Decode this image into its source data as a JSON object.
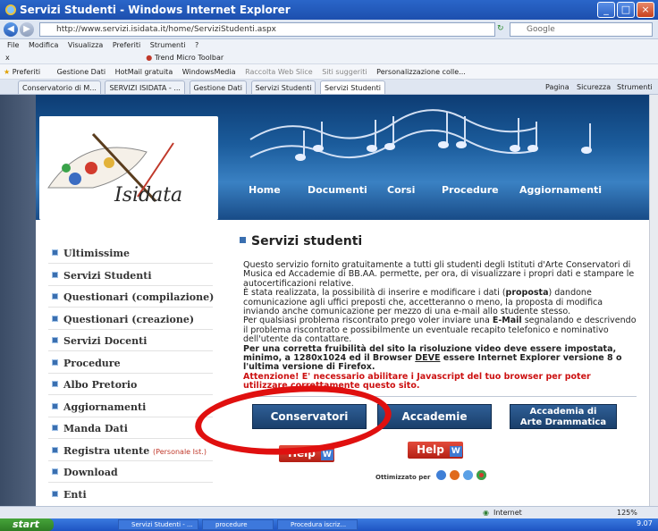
{
  "window": {
    "title": "Servizi Studenti - Windows Internet Explorer"
  },
  "address": {
    "url": "http://www.servizi.isidata.it/home/ServiziStudenti.aspx",
    "search_placeholder": "Google"
  },
  "menu": {
    "items": [
      "File",
      "Modifica",
      "Visualizza",
      "Preferiti",
      "Strumenti",
      "?"
    ]
  },
  "toolbar": {
    "trend": "Trend Micro Toolbar",
    "close": "x"
  },
  "favorites": {
    "label": "Preferiti",
    "items": [
      "Gestione Dati",
      "HotMail gratuita",
      "WindowsMedia",
      "Raccolta Web Slice",
      "Siti suggeriti",
      "Personalizzazione colle..."
    ]
  },
  "tabs": {
    "items": [
      "Conservatorio di M...",
      "SERVIZI ISIDATA - ...",
      "Gestione Dati",
      "Servizi Studenti",
      "Servizi Studenti"
    ],
    "right": [
      "Pagina",
      "Sicurezza",
      "Strumenti"
    ]
  },
  "site": {
    "logo_text": "Isidata",
    "nav": [
      "Home",
      "Documenti",
      "Corsi",
      "Procedure",
      "Aggiornamenti"
    ],
    "sidebar": [
      {
        "label": "Ultimissime"
      },
      {
        "label": "Servizi Studenti"
      },
      {
        "label": "Questionari (compilazione)"
      },
      {
        "label": "Questionari (creazione)"
      },
      {
        "label": "Servizi Docenti"
      },
      {
        "label": "Procedure"
      },
      {
        "label": "Albo Pretorio"
      },
      {
        "label": "Aggiornamenti"
      },
      {
        "label": "Manda Dati"
      },
      {
        "label": "Registra utente",
        "note": "(Personale Ist.)"
      },
      {
        "label": "Download"
      },
      {
        "label": "Enti"
      }
    ],
    "heading": "Servizi studenti",
    "para1": "Questo servizio fornito gratuitamente a tutti gli studenti degli Istituti d'Arte Conservatori di Musica ed Accademie di BB.AA. permette, per ora, di visualizzare i propri dati e stampare le autocertificazioni relative.",
    "para2_a": "È stata realizzata, la possibilità di inserire e modificare i dati (",
    "para2_b": "proposta",
    "para2_c": ") dandone comunicazione agli uffici preposti che, accetteranno o meno, la proposta di modifica inviando anche comunicazione per mezzo di una e-mail allo studente stesso.",
    "para3_a": "Per qualsiasi problema riscontrato prego voler inviare una ",
    "para3_b": "E-Mail",
    "para3_c": " segnalando e descrivendo il problema riscontrato e possibilmente un eventuale recapito telefonico e nominativo dell'utente da contattare.",
    "para4_a": "Per una corretta fruibilità del sito la risoluzione video deve essere impostata, minimo, a 1280x1024 ed il Browser ",
    "para4_b": "DEVE",
    "para4_c": " essere Internet Explorer versione 8 o l'ultima versione di Firefox.",
    "warning": "Attenzione! E' necessario abilitare i Javascript del tuo browser per poter utilizzare correttamente questo sito.",
    "buttons": {
      "conservatori": "Conservatori",
      "accademie": "Accademie",
      "arte1": "Accademia di",
      "arte2": "Arte Drammatica"
    },
    "help": "Help",
    "optimized": "Ottimizzato per"
  },
  "status": {
    "zone": "Internet",
    "zoom": "125%"
  },
  "taskbar": {
    "start": "start",
    "items": [
      "Servizi Studenti - ...",
      "procedure",
      "Procedura iscriz..."
    ],
    "clock": "9.07"
  }
}
